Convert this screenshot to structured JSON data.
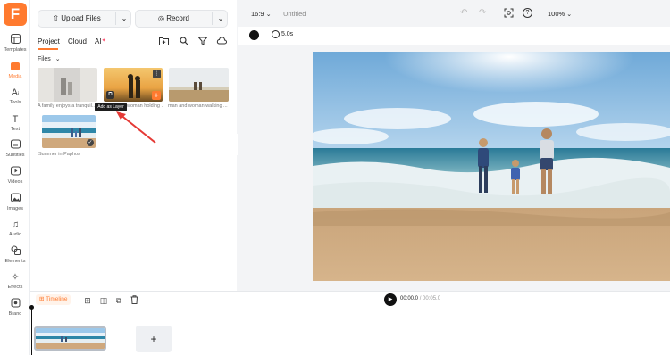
{
  "app": {
    "logo_letter": "F"
  },
  "rail": {
    "items": [
      {
        "label": "Templates",
        "icon": "templates-icon"
      },
      {
        "label": "Media",
        "icon": "media-icon",
        "active": true
      },
      {
        "label": "Tools",
        "icon": "ai-tools-icon"
      },
      {
        "label": "Text",
        "icon": "text-icon"
      },
      {
        "label": "Subtitles",
        "icon": "subtitles-icon"
      },
      {
        "label": "Videos",
        "icon": "videos-icon"
      },
      {
        "label": "Images",
        "icon": "images-icon"
      },
      {
        "label": "Audio",
        "icon": "audio-icon"
      },
      {
        "label": "Elements",
        "icon": "elements-icon"
      },
      {
        "label": "Effects",
        "icon": "effects-icon"
      },
      {
        "label": "Brand",
        "icon": "brand-icon"
      }
    ]
  },
  "panel": {
    "upload_label": "Upload Files",
    "record_label": "Record",
    "tabs": [
      {
        "label": "Project",
        "active": true
      },
      {
        "label": "Cloud"
      },
      {
        "label": "AI"
      }
    ],
    "files_label": "Files",
    "files": [
      {
        "caption": "A family enjoys a tranquil..."
      },
      {
        "caption": "woman holding ..."
      },
      {
        "caption": "man and woman walking ..."
      },
      {
        "caption": "Summer in Paphos"
      }
    ],
    "tooltip": "Add as Layer"
  },
  "toolbar": {
    "aspect": "16:9",
    "title": "Untitled",
    "zoom": "100%"
  },
  "subbar": {
    "duration": "5.0s"
  },
  "timeline": {
    "label": "Timeline",
    "current_time": "00:00.0",
    "total_time": "00:05.0"
  },
  "colors": {
    "accent": "#ff7a2f",
    "arrow": "#e53935"
  }
}
